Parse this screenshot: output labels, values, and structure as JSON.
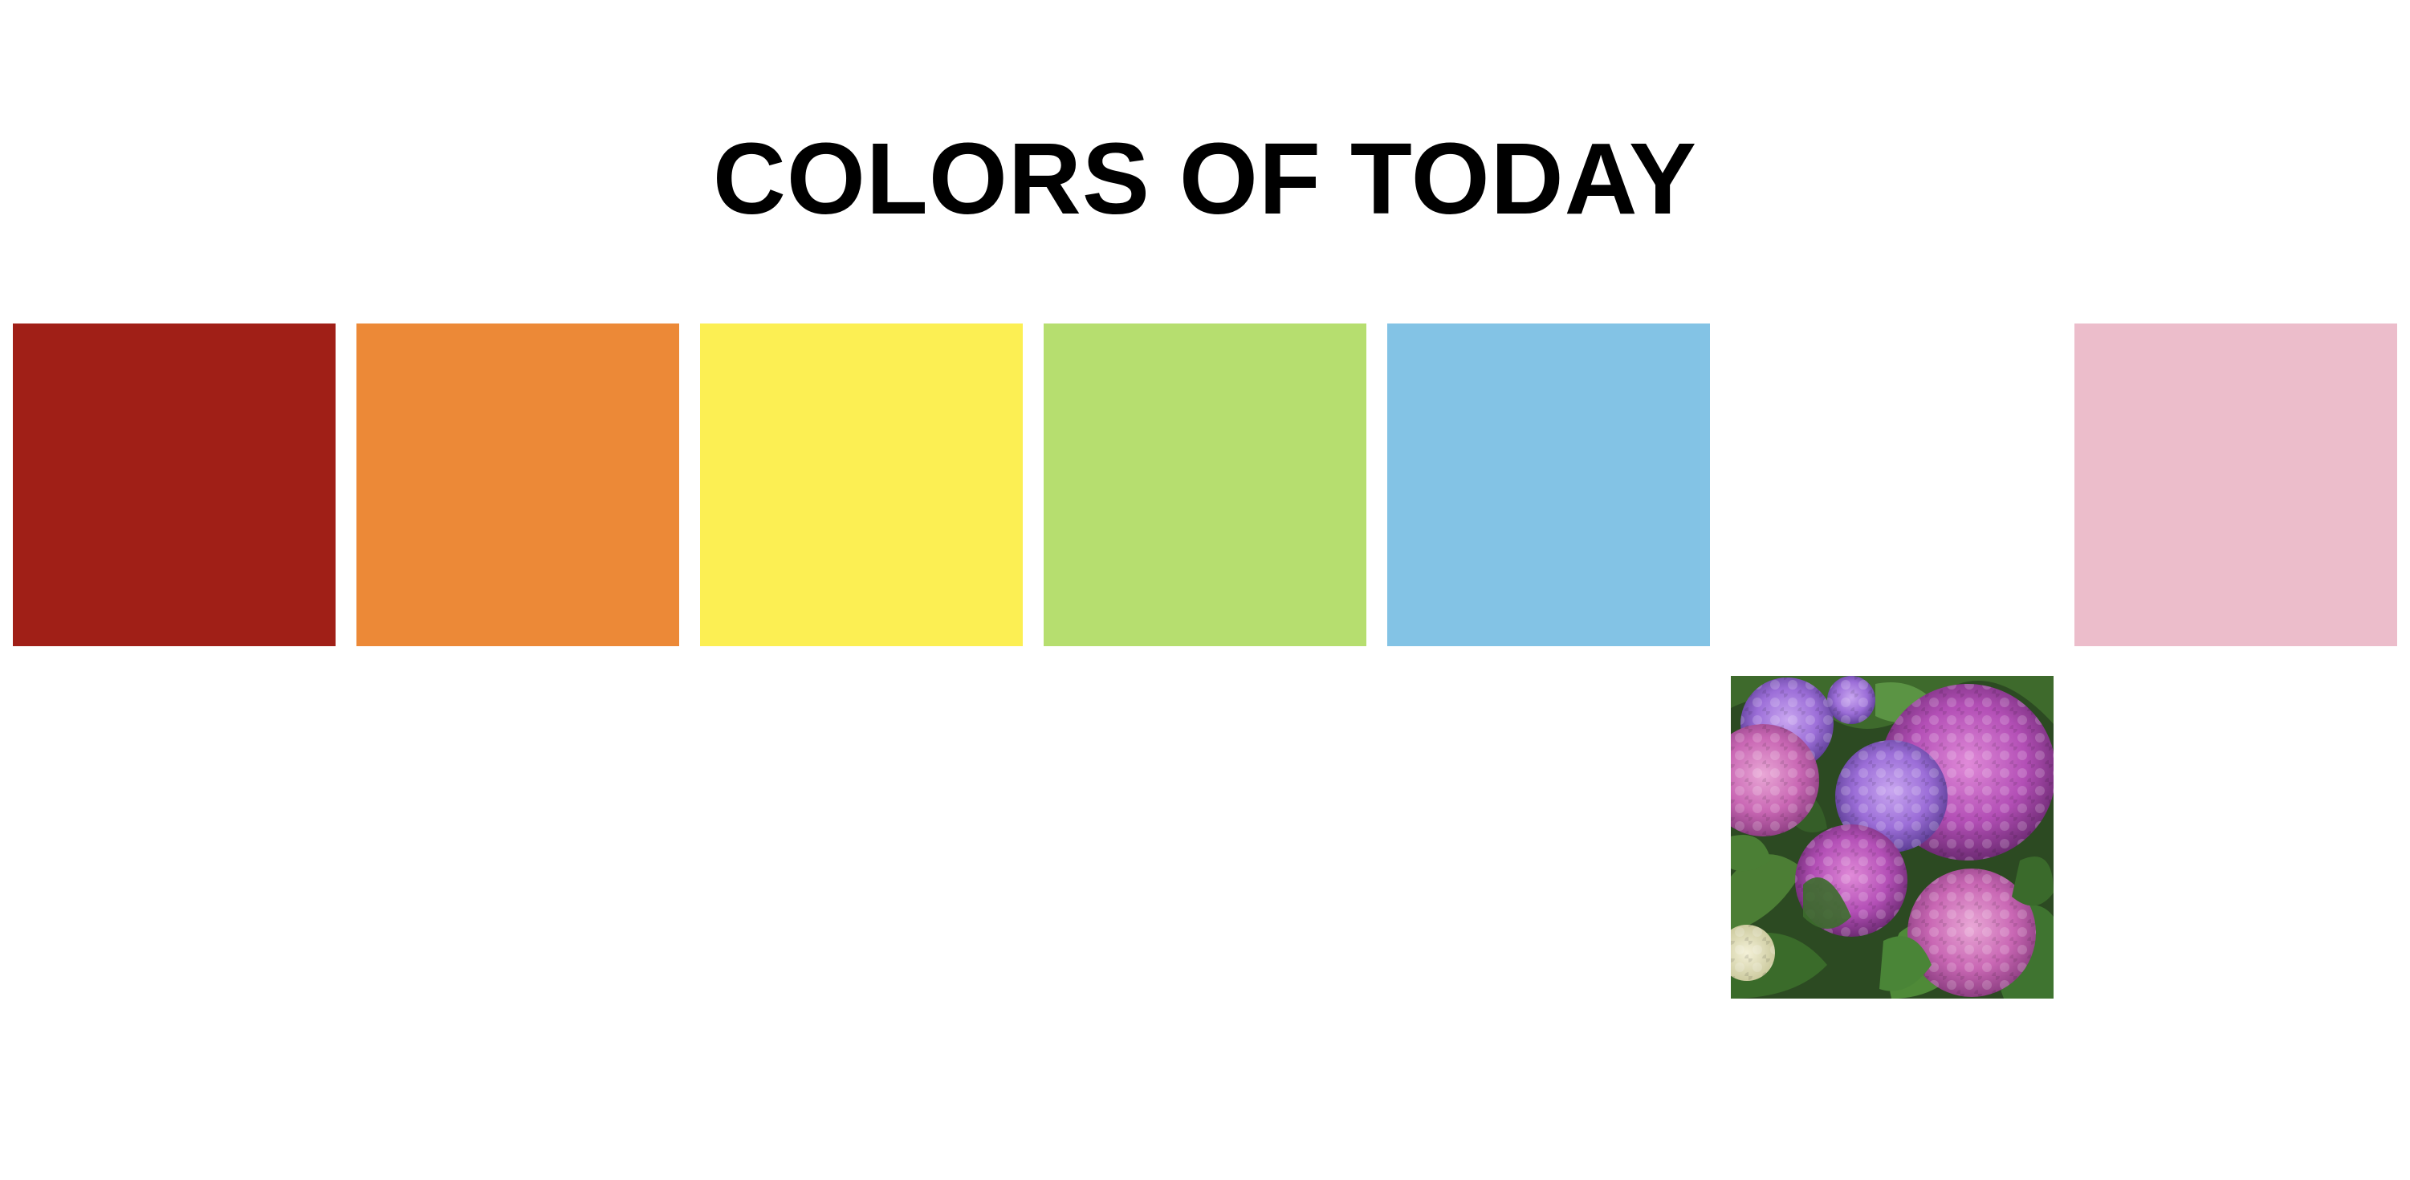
{
  "page": {
    "title": "COLORS OF TODAY"
  },
  "swatches": [
    {
      "name": "red",
      "color": "#A01F17"
    },
    {
      "name": "orange",
      "color": "#EC8937"
    },
    {
      "name": "yellow",
      "color": "#FCEF53"
    },
    {
      "name": "green",
      "color": "#B6DE6F"
    },
    {
      "name": "blue",
      "color": "#83C3E5"
    },
    {
      "name": "purple-hydrangea",
      "image": "hydrangea-photo"
    },
    {
      "name": "pink",
      "color": "#ECBDCB"
    }
  ],
  "palette": {
    "background": "#FFFFFF",
    "text": "#000000"
  }
}
